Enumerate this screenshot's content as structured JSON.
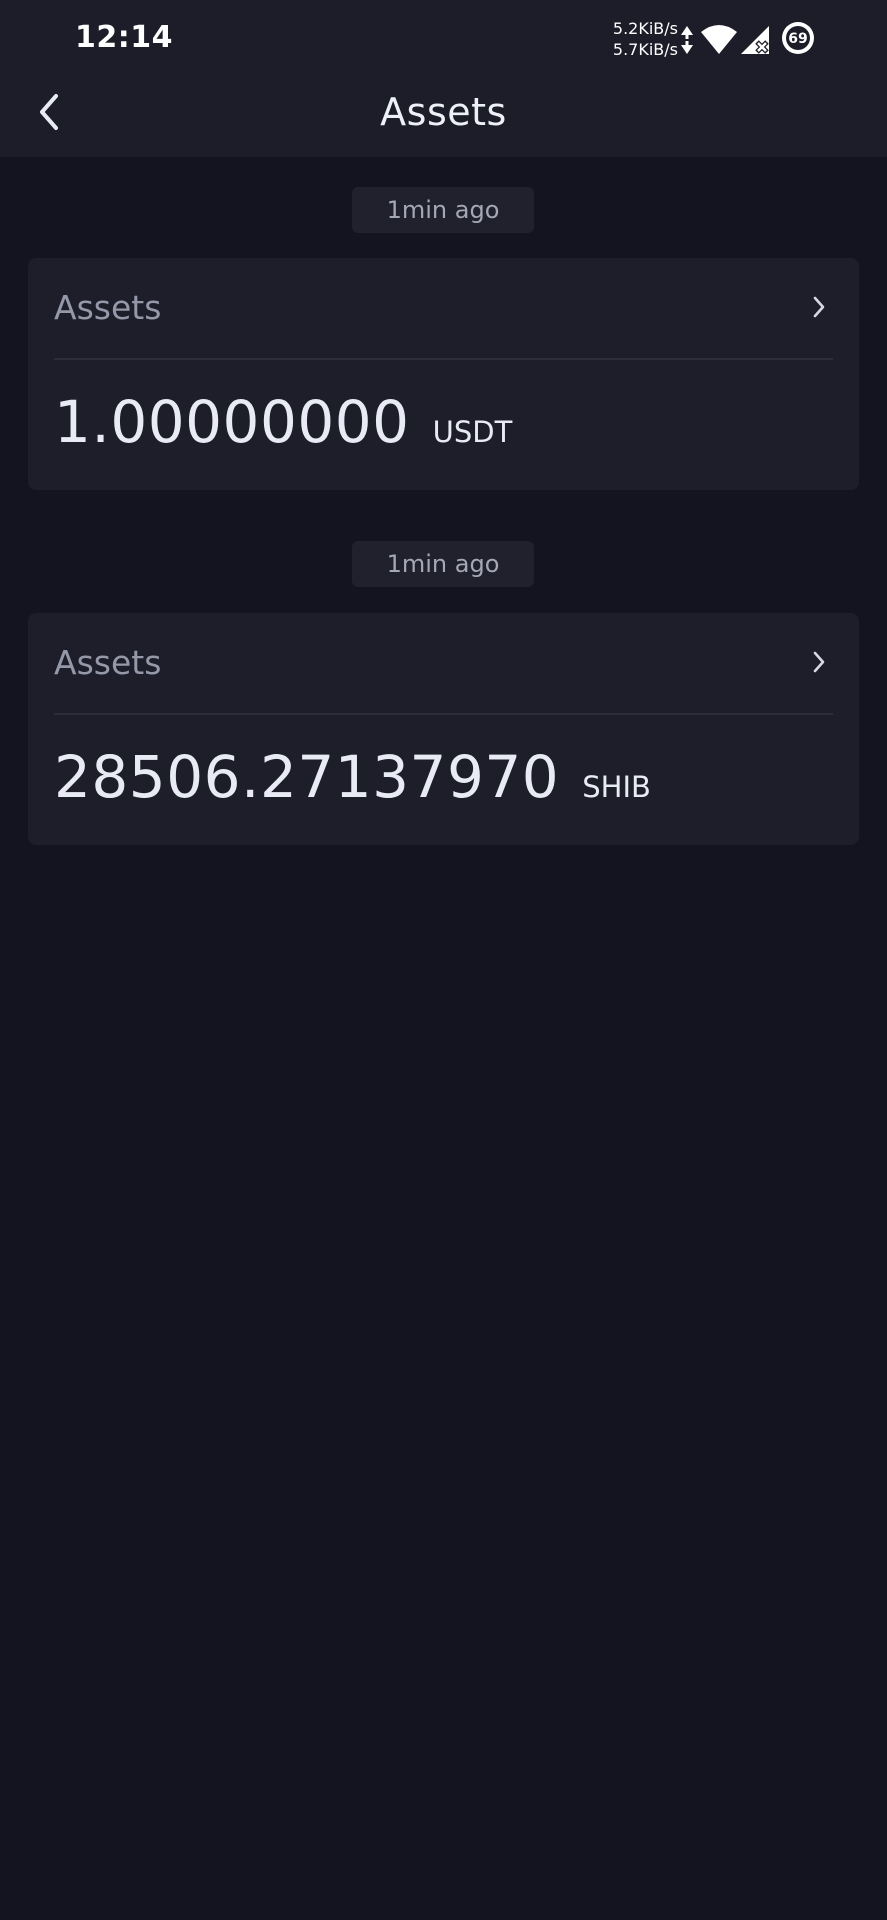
{
  "status_bar": {
    "time": "12:14",
    "upload_speed": "5.2KiB/s",
    "download_speed": "5.7KiB/s",
    "battery_level": "69",
    "icons": [
      "network-activity-icon",
      "wifi-icon",
      "cellular-signal-no-service-icon",
      "battery-icon"
    ]
  },
  "app_bar": {
    "title": "Assets",
    "back_icon": "chevron-left-icon"
  },
  "records": [
    {
      "time": "1min ago",
      "label": "Assets",
      "amount": "1.00000000",
      "unit": "USDT"
    },
    {
      "time": "1min ago",
      "label": "Assets",
      "amount": "28506.27137970",
      "unit": "SHIB"
    }
  ],
  "colors": {
    "background": "#13141f",
    "header": "#1c1d29",
    "card": "#1d1e2a",
    "chip": "#20212d",
    "muted_text": "#9598a9",
    "primary_text": "#e9ebf4"
  }
}
